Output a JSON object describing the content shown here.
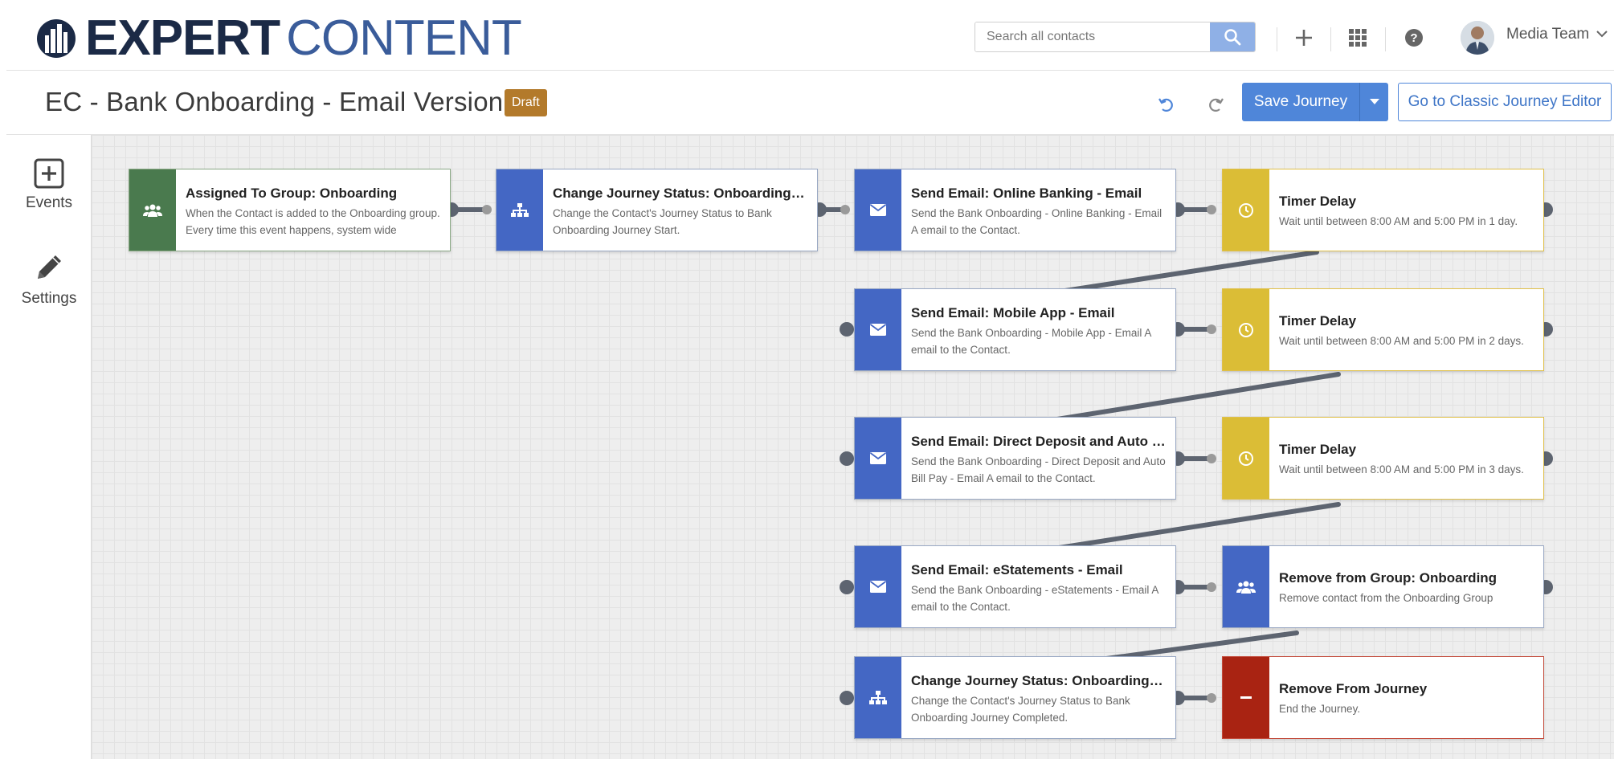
{
  "header": {
    "logo_word1": "EXPERT",
    "logo_word2": "CONTENT",
    "search_placeholder": "Search all contacts",
    "user_name": "Media Team"
  },
  "titlebar": {
    "title": "EC - Bank Onboarding - Email Version A",
    "badge": "Draft",
    "save_label": "Save Journey",
    "classic_label": "Go to Classic Journey Editor"
  },
  "sidebar": {
    "events_label": "Events",
    "settings_label": "Settings"
  },
  "colors": {
    "green": "#4a7a4e",
    "blue": "#4467c4",
    "yellow": "#dbbd36",
    "red": "#a92312",
    "accent": "#4f86d9"
  },
  "nodes": [
    {
      "icon": "group-icon",
      "title": "Assigned To Group: Onboarding",
      "desc": "When the Contact is added to the Onboarding group. Every time this event happens, system wide"
    },
    {
      "icon": "hierarchy-icon",
      "title": "Change Journey Status: Onboarding Journey Start",
      "desc": "Change the Contact's Journey Status to Bank Onboarding Journey Start."
    },
    {
      "icon": "envelope-icon",
      "title": "Send Email: Online Banking - Email",
      "desc": "Send the Bank Onboarding - Online Banking - Email A email to the Contact."
    },
    {
      "icon": "clock-icon",
      "title": "Timer Delay",
      "desc": "Wait until between 8:00 AM and 5:00 PM in 1 day."
    },
    {
      "icon": "envelope-icon",
      "title": "Send Email: Mobile App - Email",
      "desc": "Send the Bank Onboarding - Mobile App - Email A email to the Contact."
    },
    {
      "icon": "clock-icon",
      "title": "Timer Delay",
      "desc": "Wait until between 8:00 AM and 5:00 PM in 2 days."
    },
    {
      "icon": "envelope-icon",
      "title": "Send Email: Direct Deposit and Auto Bill Pay - Email",
      "desc": "Send the Bank Onboarding - Direct Deposit and Auto Bill Pay - Email A email to the Contact."
    },
    {
      "icon": "clock-icon",
      "title": "Timer Delay",
      "desc": "Wait until between 8:00 AM and 5:00 PM in 3 days."
    },
    {
      "icon": "envelope-icon",
      "title": "Send Email: eStatements - Email",
      "desc": "Send the Bank Onboarding - eStatements - Email A email to the Contact."
    },
    {
      "icon": "group-icon",
      "title": "Remove from Group: Onboarding",
      "desc": "Remove contact from the Onboarding Group"
    },
    {
      "icon": "hierarchy-icon",
      "title": "Change Journey Status: Onboarding Journey Completed",
      "desc": "Change the Contact's Journey Status to Bank Onboarding Journey Completed."
    },
    {
      "icon": "minus-icon",
      "title": "Remove From Journey",
      "desc": "End the Journey."
    }
  ]
}
